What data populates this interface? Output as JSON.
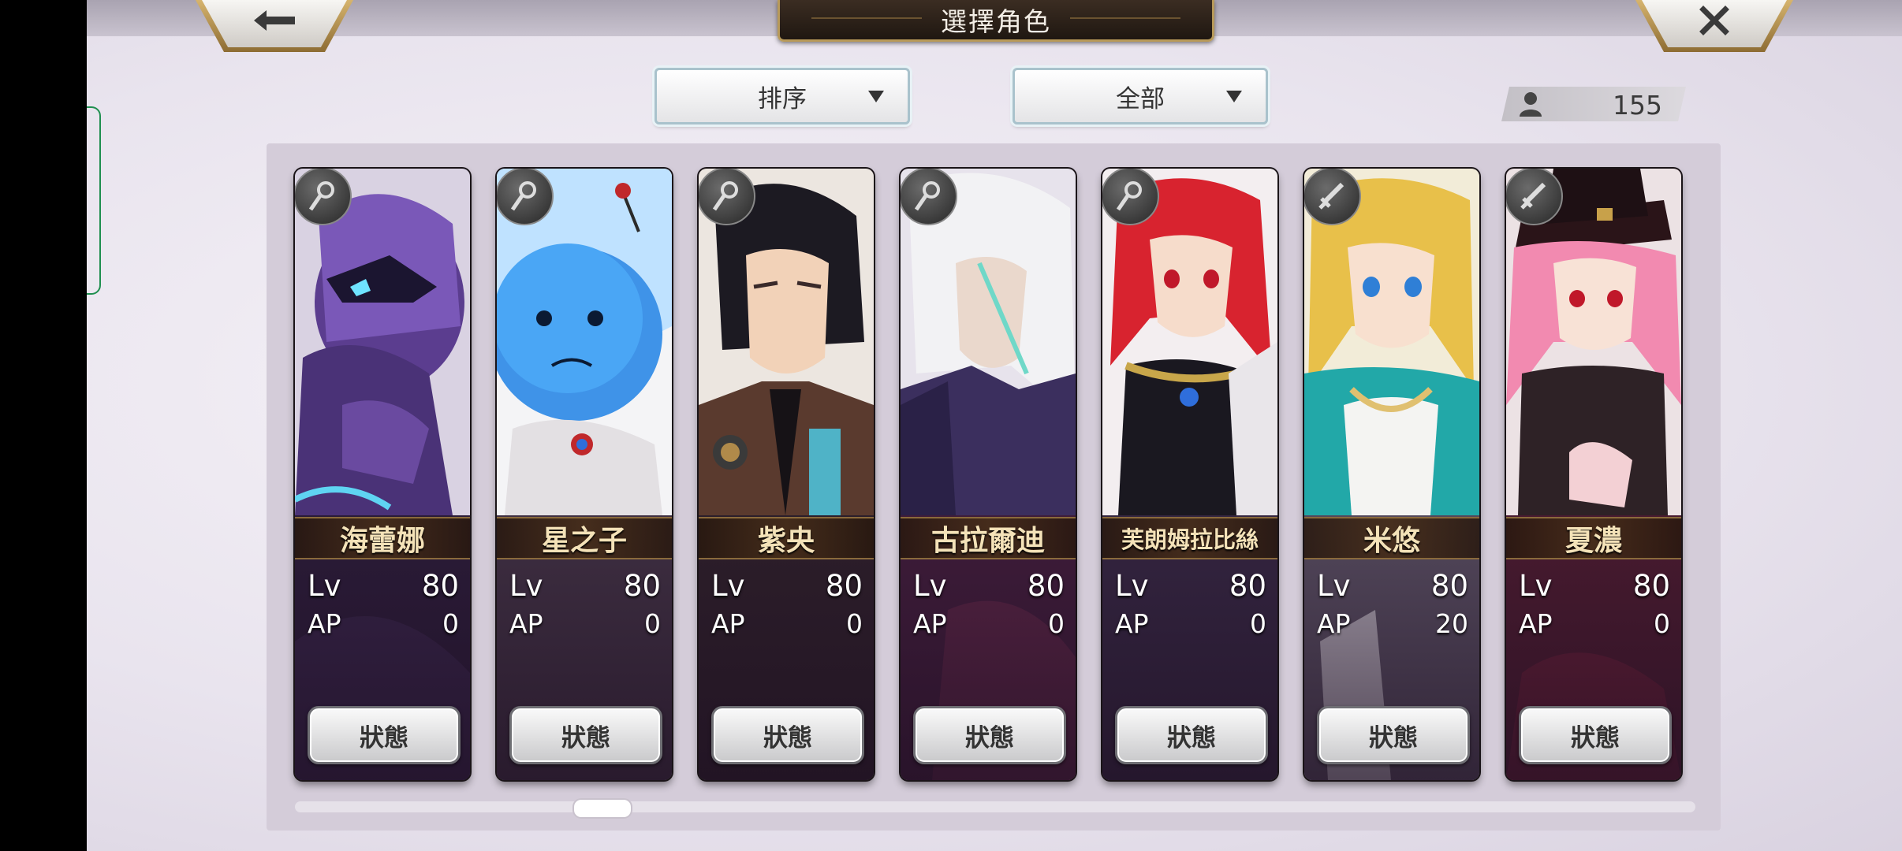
{
  "header": {
    "title": "選擇角色",
    "back_icon": "arrow-left-icon",
    "close_icon": "close-icon"
  },
  "filters": {
    "sort": {
      "label": "排序"
    },
    "category": {
      "label": "全部"
    }
  },
  "roster": {
    "count": "155",
    "icon": "person-icon"
  },
  "status_label": "狀態",
  "lv_label": "Lv",
  "ap_label": "AP",
  "characters": [
    {
      "name": "海蕾娜",
      "lv": "80",
      "ap": "0",
      "weapon": "staff"
    },
    {
      "name": "星之子",
      "lv": "80",
      "ap": "0",
      "weapon": "staff"
    },
    {
      "name": "紫央",
      "lv": "80",
      "ap": "0",
      "weapon": "staff"
    },
    {
      "name": "古拉爾迪",
      "lv": "80",
      "ap": "0",
      "weapon": "staff"
    },
    {
      "name": "芙朗姆拉比絲",
      "lv": "80",
      "ap": "0",
      "weapon": "staff"
    },
    {
      "name": "米悠",
      "lv": "80",
      "ap": "20",
      "weapon": "sword"
    },
    {
      "name": "夏濃",
      "lv": "80",
      "ap": "0",
      "weapon": "sword"
    }
  ],
  "colors": {
    "gold": "#b89a5a",
    "name_text": "#f4e2b8",
    "panel": "#d4ccd9"
  }
}
